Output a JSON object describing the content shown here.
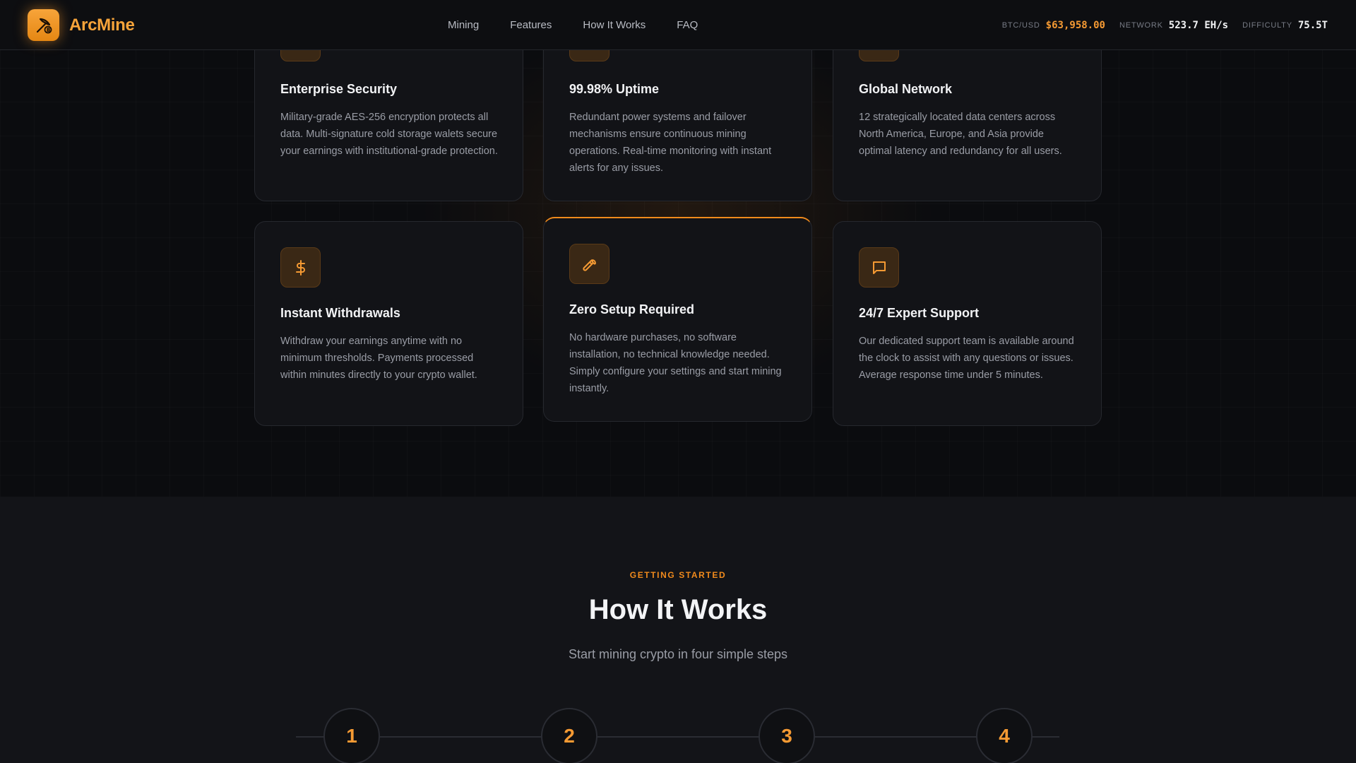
{
  "brand": {
    "name": "ArcMine",
    "icon": "pickaxe-bitcoin-icon"
  },
  "nav": {
    "items": [
      {
        "label": "Mining"
      },
      {
        "label": "Features"
      },
      {
        "label": "How It Works"
      },
      {
        "label": "FAQ"
      }
    ]
  },
  "stats": {
    "btc_label": "BTC/USD",
    "btc_value": "$63,958.00",
    "network_label": "NETWORK",
    "network_value": "523.7 EH/s",
    "difficulty_label": "DIFFICULTY",
    "difficulty_value": "75.5T"
  },
  "features": [
    {
      "title": "Enterprise Security",
      "desc": "Military-grade AES-256 encryption protects all data. Multi-signature cold storage walets secure your earnings with institutional-grade protection.",
      "icon": "shield-icon"
    },
    {
      "title": "99.98% Uptime",
      "desc": "Redundant power systems and failover mechanisms ensure continuous mining operations. Real-time monitoring with instant alerts for any issues.",
      "icon": "lightning-icon"
    },
    {
      "title": "Global Network",
      "desc": "12 strategically located data centers across North America, Europe, and Asia provide optimal latency and redundancy for all users.",
      "icon": "globe-icon"
    },
    {
      "title": "Instant Withdrawals",
      "desc": "Withdraw your earnings anytime with no minimum thresholds. Payments processed within minutes directly to your crypto wallet.",
      "icon": "dollar-icon"
    },
    {
      "title": "Zero Setup Required",
      "desc": "No hardware purchases, no software installation, no technical knowledge needed. Simply configure your settings and start mining instantly.",
      "icon": "wrench-icon"
    },
    {
      "title": "24/7 Expert Support",
      "desc": "Our dedicated support team is available around the clock to assist with any questions or issues. Average response time under 5 minutes.",
      "icon": "chat-bubble-icon"
    }
  ],
  "how": {
    "eyebrow": "GETTING STARTED",
    "title": "How It Works",
    "subtitle": "Start mining crypto in four simple steps",
    "steps": [
      "1",
      "2",
      "3",
      "4"
    ]
  },
  "colors": {
    "accent": "#f08a1c",
    "background": "#0b0c0f",
    "card": "#121317"
  }
}
